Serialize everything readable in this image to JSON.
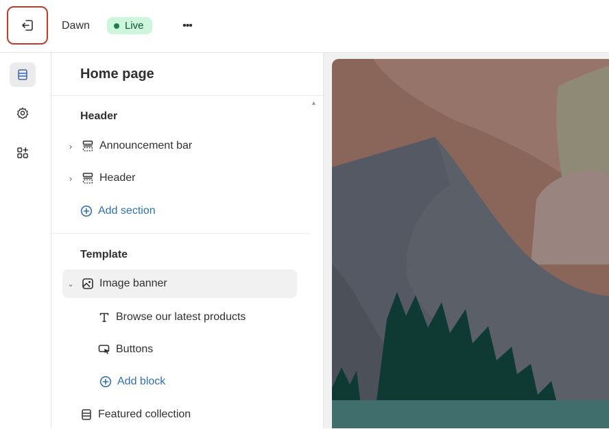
{
  "topbar": {
    "exit_label": "Exit",
    "theme_name": "Dawn",
    "status": "Live",
    "more": "•••",
    "colors": {
      "live_bg": "#cdf6dd",
      "live_dot": "#1a7f4b",
      "exit_outline": "#c0392b"
    }
  },
  "rail": {
    "items": [
      {
        "icon": "sections-icon",
        "active": true
      },
      {
        "icon": "gear-icon",
        "active": false
      },
      {
        "icon": "apps-add-icon",
        "active": false
      }
    ]
  },
  "sidebar": {
    "title": "Home page",
    "groups": {
      "header": {
        "title": "Header",
        "items": [
          "Announcement bar",
          "Header"
        ],
        "add_section": "Add section"
      },
      "template": {
        "title": "Template",
        "image_banner": "Image banner",
        "blocks": [
          "Browse our latest products",
          "Buttons"
        ],
        "add_block": "Add block",
        "featured": "Featured collection"
      }
    },
    "colors": {
      "link": "#2f6fb3",
      "selected_bg": "#f1f1f1"
    }
  },
  "preview": {
    "colors": {
      "sky": "#8a665a",
      "mountain": "#5a5f68",
      "forest": "#0f3a33",
      "water": "#3f6e6c"
    }
  }
}
